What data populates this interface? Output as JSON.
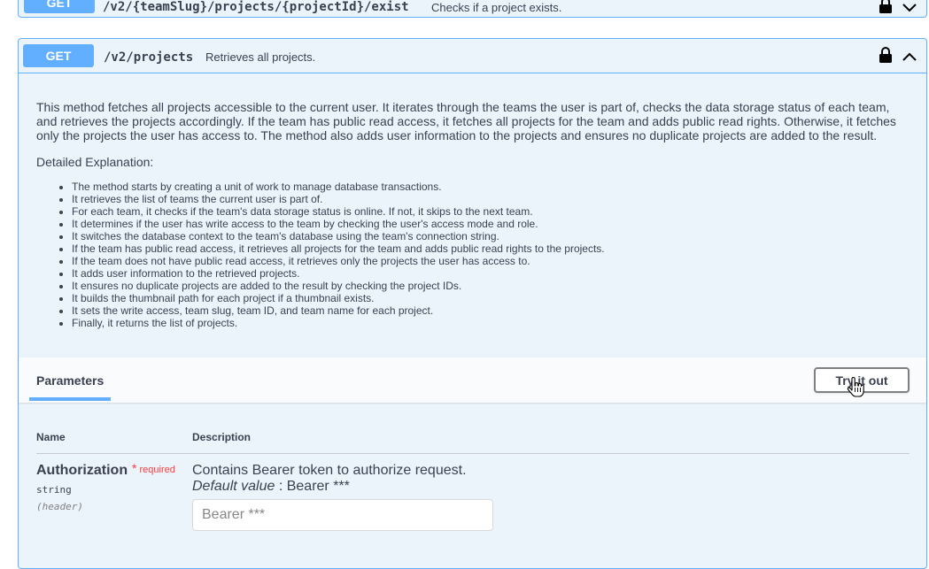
{
  "colors": {
    "get_method": "#61affe",
    "op_background": "#ebf3fb",
    "required": "#ff3b3b",
    "text": "#3b4151"
  },
  "prev_operation": {
    "method": "GET",
    "path": "/v2/{teamSlug}/projects/{projectId}/exist",
    "summary": "Checks if a project exists.",
    "lock_icon": "lock-icon",
    "chevron_icon": "chevron-down-icon"
  },
  "operation": {
    "method": "GET",
    "path": "/v2/projects",
    "summary": "Retrieves all projects.",
    "lock_icon": "lock-icon",
    "chevron_icon": "chevron-up-icon",
    "description": "This method fetches all projects accessible to the current user. It iterates through the teams the user is part of, checks the data storage status of each team, and retrieves the projects accordingly. If the team has public read access, it fetches all projects for the team and adds public read rights. Otherwise, it fetches only the projects the user has access to. The method also adds user information to the projects and ensures no duplicate projects are added to the result.",
    "detail_heading": "Detailed Explanation:",
    "details": [
      "The method starts by creating a unit of work to manage database transactions.",
      "It retrieves the list of teams the current user is part of.",
      "For each team, it checks if the team's data storage status is online. If not, it skips to the next team.",
      "It determines if the user has write access to the team by checking the user's access mode and role.",
      "It switches the database context to the team's database using the team's connection string.",
      "If the team has public read access, it retrieves all projects for the team and adds public read rights to the projects.",
      "If the team does not have public read access, it retrieves only the projects the user has access to.",
      "It adds user information to the retrieved projects.",
      "It ensures no duplicate projects are added to the result by checking the project IDs.",
      "It builds the thumbnail path for each project if a thumbnail exists.",
      "It sets the write access, team slug, team ID, and team name for each project.",
      "Finally, it returns the list of projects."
    ],
    "parameters_tab": "Parameters",
    "try_button": "Try it out",
    "columns": {
      "name": "Name",
      "description": "Description"
    },
    "param": {
      "name": "Authorization",
      "required_star": "*",
      "required_label": "required",
      "type": "string",
      "in": "(header)",
      "description": "Contains Bearer token to authorize request.",
      "default_label": "Default value",
      "default_sep": " : ",
      "default_value": "Bearer ***",
      "placeholder": "Bearer ***"
    }
  }
}
